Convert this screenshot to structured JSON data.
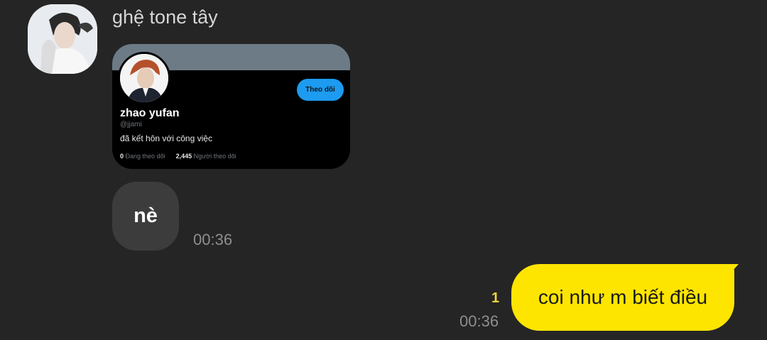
{
  "chat": {
    "sender_name": "ghệ tone tây"
  },
  "profile_card": {
    "name": "zhao yufan",
    "handle": "@jjami",
    "bio": "đã kết hôn với công việc",
    "following_count": "0",
    "following_label": "Đang theo dõi",
    "followers_count": "2,445",
    "followers_label": "Người theo dõi",
    "follow_button_label": "Theo dõi"
  },
  "messages": [
    {
      "direction": "incoming",
      "text": "nè",
      "time": "00:36"
    },
    {
      "direction": "outgoing",
      "text": "coi như m biết điều",
      "time": "00:36",
      "unread_count": "1"
    }
  ],
  "colors": {
    "background": "#252525",
    "incoming_bubble": "#3c3c3c",
    "outgoing_bubble": "#fee500",
    "follow_button": "#1d9bf0",
    "unread_count": "#f3d23c"
  }
}
